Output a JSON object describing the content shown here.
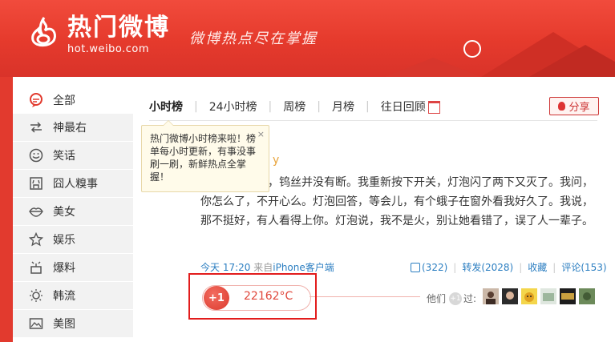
{
  "header": {
    "logo_title": "热门微博",
    "logo_url": "hot.weibo.com",
    "slogan": "微博热点尽在掌握"
  },
  "sidebar": {
    "items": [
      {
        "label": "全部",
        "icon": "chat-bubble-icon"
      },
      {
        "label": "神最右",
        "icon": "arrows-icon"
      },
      {
        "label": "笑话",
        "icon": "smiley-icon"
      },
      {
        "label": "囧人糗事",
        "icon": "jiong-icon"
      },
      {
        "label": "美女",
        "icon": "lips-icon"
      },
      {
        "label": "娱乐",
        "icon": "star-icon"
      },
      {
        "label": "爆料",
        "icon": "broadcast-icon"
      },
      {
        "label": "韩流",
        "icon": "eye-icon"
      },
      {
        "label": "美图",
        "icon": "picture-icon"
      }
    ]
  },
  "tabs": {
    "items": [
      "小时榜",
      "24小时榜",
      "周榜",
      "月榜",
      "往日回顾"
    ]
  },
  "share_label": "分享",
  "tooltip": {
    "text": "热门微博小时榜来啦！榜单每小时更新，有事没事刷一刷，新鲜热点全掌握！",
    "close": "×"
  },
  "post": {
    "head_partial": "y",
    "text": "仔细检查了下，钨丝并没有断。我重新按下开关，灯泡闪了两下又灭了。我问，你怎么了，不开心么。灯泡回答，等会儿，有个蛾子在窗外看我好久了。我说，那不挺好，有人看得上你。灯泡说，我不是火，别让她看错了，误了人一辈子。",
    "time": "今天 17:20",
    "source_prefix": "来自",
    "source": "iPhone客户端",
    "likes": "(322)",
    "repost": "转发(2028)",
    "favorite": "收藏",
    "comment": "评论(153)"
  },
  "heat": {
    "plus": "+1",
    "value": "22162°C",
    "others_label": "他们",
    "others_plus": "+1",
    "others_suffix": "过:"
  },
  "colors": {
    "brand_red": "#e23a2e",
    "link_blue": "#2b7ec1",
    "highlight_box": "#e21c1c"
  }
}
